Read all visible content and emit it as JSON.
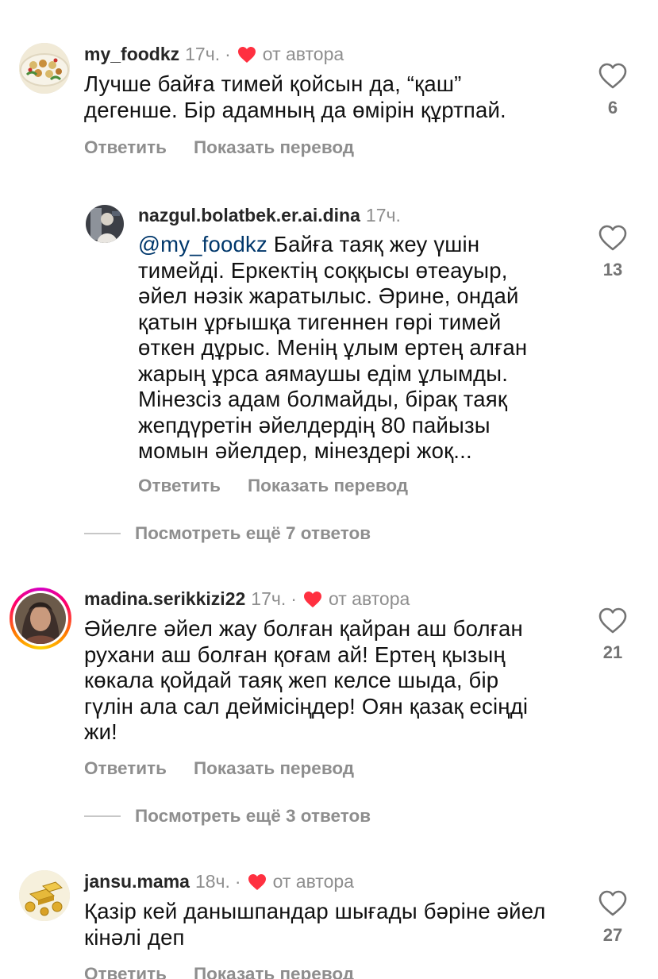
{
  "comments": [
    {
      "username": "my_foodkz",
      "time": "17ч.",
      "separator": "·",
      "by_author": "от автора",
      "lines": [
        "Лучше байға тимей қойсын да, “қаш”",
        "дегенше. Бір адамның да өмірін құртпай."
      ],
      "reply_label": "Ответить",
      "translate_label": "Показать перевод",
      "likes": "6",
      "avatar": "food-platter-avatar"
    },
    {
      "username": "nazgul.bolatbek.er.ai.dina",
      "time": "17ч.",
      "mention": "@my_foodkz",
      "first_line_rest": " Байға таяқ жеу үшін",
      "lines": [
        "тимейді. Еркектің соққысы өтеауыр,",
        "әйел нәзік жаратылыс. Әрине,  ондай",
        "қатын ұрғышқа тигеннен гөрі тимей",
        "өткен дұрыс. Менің ұлым ертең алған",
        "жарың ұрса аямаушы едім ұлымды.",
        "Мінезсіз адам болмайды, бірақ таяқ",
        "жепдүретін әйелдердің 80 пайызы",
        "момын әйелдер,  мінездері жоқ..."
      ],
      "reply_label": "Ответить",
      "translate_label": "Показать перевод",
      "likes": "13",
      "avatar": "person-avatar"
    },
    {
      "username": "madina.serikkizi22",
      "time": "17ч.",
      "separator": "·",
      "by_author": "от автора",
      "lines": [
        "Әйелге әйел жау болған қайран аш болған",
        "рухани аш болған қоғам ай! Ертең қызың",
        "көкала қойдай таяқ жеп келсе шыда, бір",
        "гүлін ала сал деймісіңдер! Оян қазақ есіңді",
        "жи!"
      ],
      "reply_label": "Ответить",
      "translate_label": "Показать перевод",
      "likes": "21",
      "avatar": "woman-portrait-avatar"
    },
    {
      "username": "jansu.mama",
      "time": "18ч.",
      "separator": "·",
      "by_author": "от автора",
      "lines": [
        "Қазір кей данышпандар шығады бәріне әйел",
        "кінәлі деп"
      ],
      "reply_label": "Ответить",
      "translate_label": "Показать перевод",
      "likes": "27",
      "avatar": "gold-bars-avatar"
    }
  ],
  "more_replies": [
    {
      "label": "Посмотреть ещё 7 ответов"
    },
    {
      "label": "Посмотреть ещё 3 ответов"
    }
  ],
  "colors": {
    "heart_red": "#ff3040",
    "secondary_text": "#8e8e8e",
    "mention_blue": "#00376b"
  }
}
